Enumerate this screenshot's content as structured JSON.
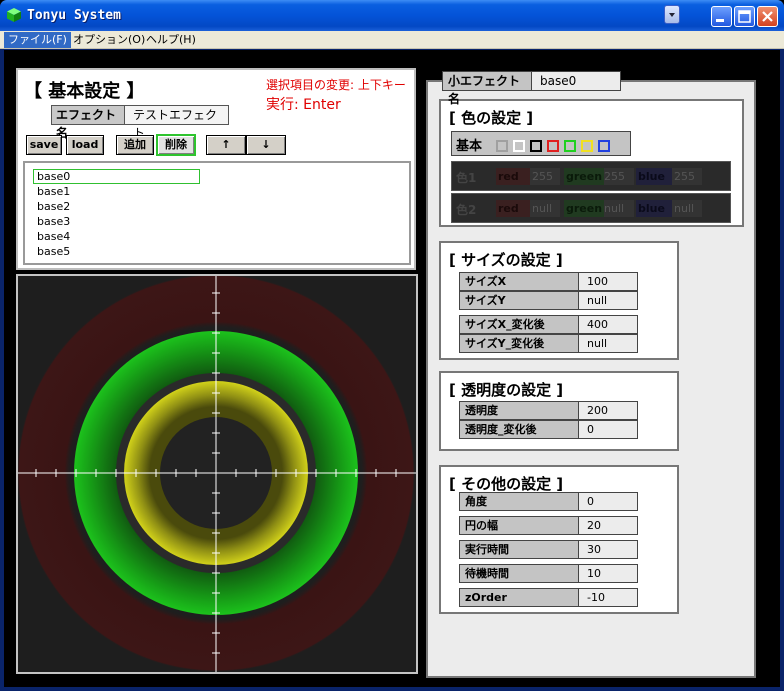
{
  "window": {
    "title": "Tonyu System"
  },
  "menu": [
    {
      "label": "ファイル(F)",
      "active": true
    },
    {
      "label": "オプション(O)",
      "active": false
    },
    {
      "label": "ヘルプ(H)",
      "active": false
    }
  ],
  "basic": {
    "title": "【 基本設定 】",
    "hint1": "選択項目の変更: 上下キー",
    "hint2": "実行: Enter",
    "effect_name_label": "エフェクト名",
    "effect_name_value": "テストエフェクト",
    "buttons": {
      "save": "save",
      "load": "load",
      "add": "追加",
      "delete": "削除",
      "up": "↑",
      "down": "↓"
    },
    "list": [
      "base0",
      "base1",
      "base2",
      "base3",
      "base4",
      "base5"
    ],
    "selected_index": 0
  },
  "sub_effect": {
    "label": "小エフェクト名",
    "value": "base0"
  },
  "color": {
    "title": "[ 色の設定 ]",
    "basic_label": "基本",
    "swatches": [
      "#a0a0a0",
      "#ffffff",
      "#000000",
      "#e02020",
      "#20d020",
      "#f0e020",
      "#2040e0"
    ],
    "color1": {
      "label": "色1",
      "red_label": "red",
      "red": "255",
      "green_label": "green",
      "green": "255",
      "blue_label": "blue",
      "blue": "255"
    },
    "color2": {
      "label": "色2",
      "red_label": "red",
      "red": "null",
      "green_label": "green",
      "green": "null",
      "blue_label": "blue",
      "blue": "null"
    }
  },
  "size": {
    "title": "[ サイズの設定 ]",
    "rows": [
      {
        "label": "サイズX",
        "value": "100"
      },
      {
        "label": "サイズY",
        "value": "null"
      },
      {
        "label": "サイズX_変化後",
        "value": "400"
      },
      {
        "label": "サイズY_変化後",
        "value": "null"
      }
    ]
  },
  "alpha": {
    "title": "[ 透明度の設定 ]",
    "rows": [
      {
        "label": "透明度",
        "value": "200"
      },
      {
        "label": "透明度_変化後",
        "value": "0"
      }
    ]
  },
  "other": {
    "title": "[ その他の設定 ]",
    "rows": [
      {
        "label": "角度",
        "value": "0"
      },
      {
        "label": "円の幅",
        "value": "20"
      },
      {
        "label": "実行時間",
        "value": "30"
      },
      {
        "label": "待機時間",
        "value": "10"
      },
      {
        "label": "zOrder",
        "value": "-10"
      }
    ]
  }
}
